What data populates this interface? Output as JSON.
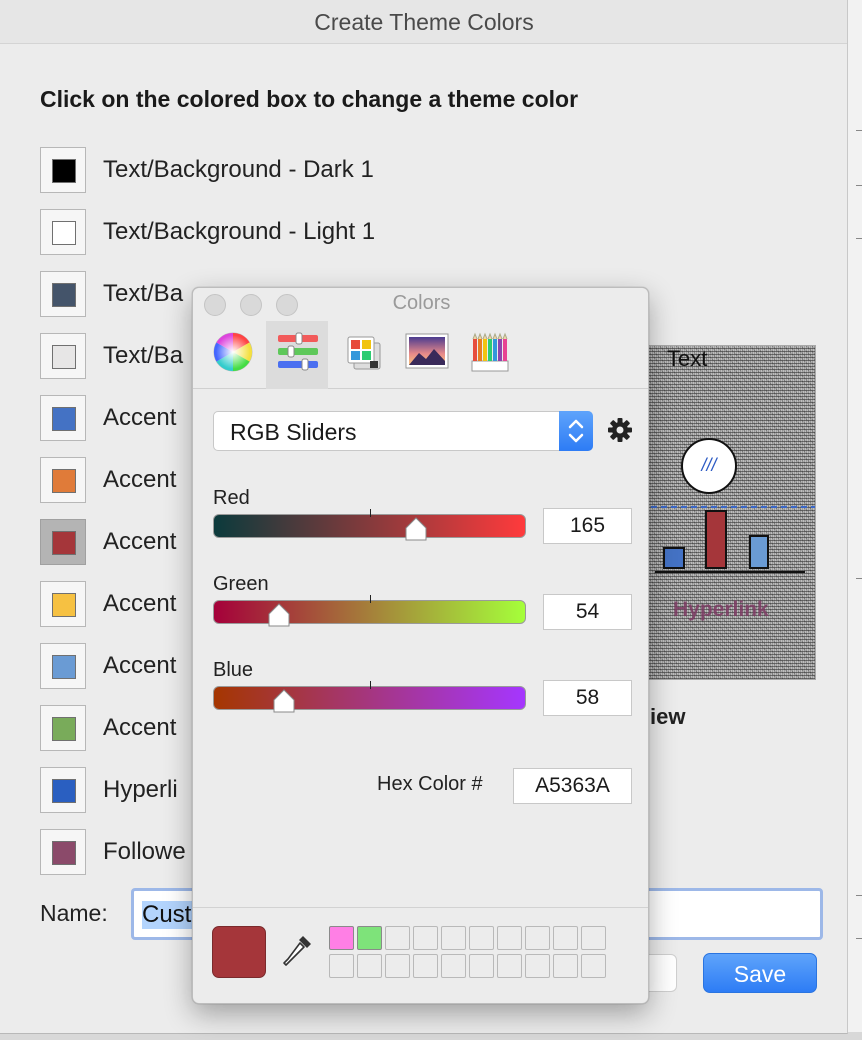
{
  "dialog": {
    "title": "Create Theme Colors",
    "heading": "Click on the colored box to change a theme color",
    "theme_colors": [
      {
        "label": "Text/Background - Dark 1",
        "color": "#000000"
      },
      {
        "label": "Text/Background - Light 1",
        "color": "#ffffff"
      },
      {
        "label": "Text/Ba",
        "color": "#44546a"
      },
      {
        "label": "Text/Ba",
        "color": "#e7e6e6"
      },
      {
        "label": "Accent",
        "color": "#4472c4"
      },
      {
        "label": "Accent",
        "color": "#e07b39"
      },
      {
        "label": "Accent",
        "color": "#a5363a"
      },
      {
        "label": "Accent",
        "color": "#f6c142"
      },
      {
        "label": "Accent",
        "color": "#6a9bd4"
      },
      {
        "label": "Accent",
        "color": "#79ab5a"
      },
      {
        "label": "Hyperli",
        "color": "#2a5fc1"
      },
      {
        "label": "Followe",
        "color": "#8b4a6a"
      }
    ],
    "name_label": "Name:",
    "name_value": "Cust",
    "save_label": "Save",
    "preview_text": "Text",
    "preview_hyperlink": "Hyperlink",
    "preview_label_partial": "iew",
    "preview_bars": [
      {
        "color": "#4472c4",
        "value": 0.35
      },
      {
        "color": "#a5363a",
        "value": 0.95
      },
      {
        "color": "#6a9bd4",
        "value": 0.55
      }
    ]
  },
  "colors_panel": {
    "title": "Colors",
    "tabs": [
      {
        "name": "color-wheel"
      },
      {
        "name": "color-sliders"
      },
      {
        "name": "color-palettes"
      },
      {
        "name": "image-palettes"
      },
      {
        "name": "pencils"
      }
    ],
    "active_tab": 1,
    "mode": "RGB Sliders",
    "channels": [
      {
        "label": "Red",
        "value": "165",
        "fraction": 0.647,
        "gradient": [
          "#0b3a3c",
          "#ff3a3c"
        ]
      },
      {
        "label": "Green",
        "value": "54",
        "fraction": 0.212,
        "gradient": [
          "#a5003a",
          "#a5ff3a"
        ]
      },
      {
        "label": "Blue",
        "value": "58",
        "fraction": 0.227,
        "gradient": [
          "#a53600",
          "#a536ff"
        ]
      }
    ],
    "hex_label": "Hex Color #",
    "hex_value": "A5363A",
    "current_color": "#a5363a",
    "saved_swatches": [
      "#ff7fe5",
      "#7ee37a"
    ]
  }
}
